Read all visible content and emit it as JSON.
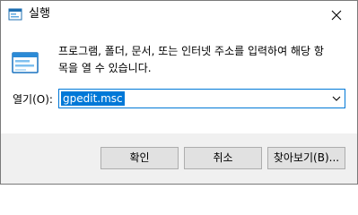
{
  "window": {
    "title": "실행",
    "app_icon": "run-dialog-icon",
    "close_icon": "close-icon"
  },
  "body": {
    "icon": "run-icon",
    "description": "프로그램, 폴더, 문서, 또는 인터넷 주소를 입력하여 해당 항\n목을 열 수 있습니다.",
    "open_label": "열기(O):",
    "open_value": "gpedit.msc",
    "dropdown_icon": "chevron-down-icon"
  },
  "buttons": {
    "ok": "확인",
    "cancel": "취소",
    "browse": "찾아보기(B)..."
  },
  "colors": {
    "accent": "#0078d7",
    "footer": "#f0f0f0",
    "button": "#e1e1e1",
    "button_border": "#adadad"
  }
}
